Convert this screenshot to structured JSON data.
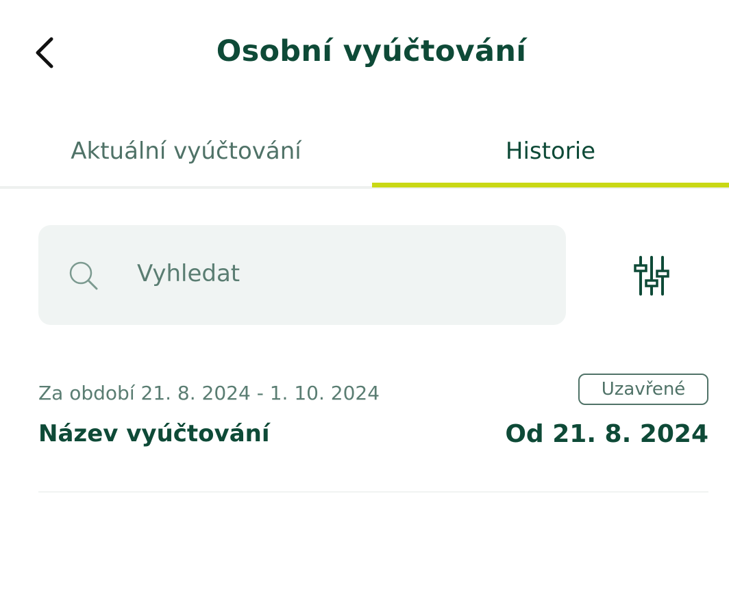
{
  "header": {
    "title": "Osobní vyúčtování",
    "back_icon": "chevron-left-icon"
  },
  "tabs": [
    {
      "label": "Aktuální vyúčtování",
      "active": false
    },
    {
      "label": "Historie",
      "active": true
    }
  ],
  "search": {
    "placeholder": "Vyhledat",
    "value": "",
    "icon": "search-icon",
    "filter_icon": "sliders-icon"
  },
  "items": [
    {
      "period": "Za období 21. 8. 2024 - 1. 10. 2024",
      "name": "Název vyúčtování",
      "status": "Uzavřené",
      "date": "Od 21. 8. 2024"
    }
  ],
  "colors": {
    "primary_text": "#0e4a37",
    "secondary_text": "#4f7267",
    "accent": "#c9d816",
    "search_bg": "#f0f4f3"
  }
}
